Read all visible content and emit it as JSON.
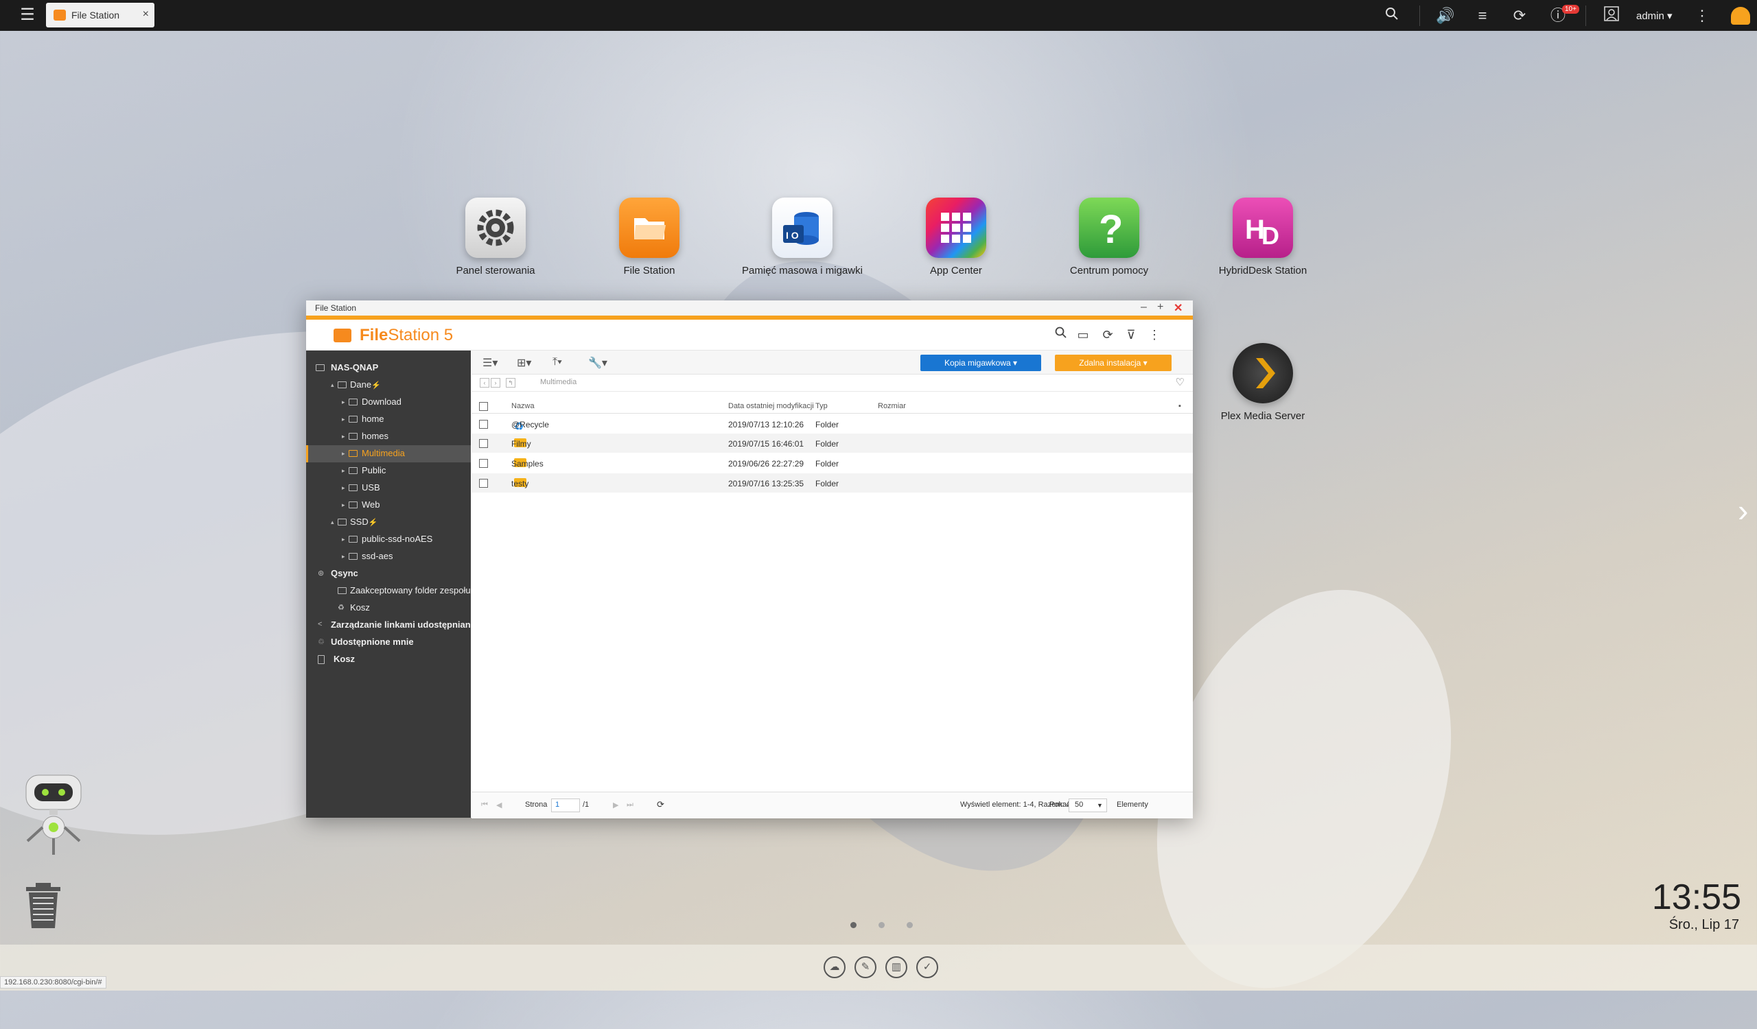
{
  "topbar": {
    "tab_label": "File Station",
    "tab_close": "×",
    "user": "admin ▾",
    "notify_badge": "10+"
  },
  "desktop": {
    "icons": [
      {
        "label": "Panel sterowania"
      },
      {
        "label": "File Station"
      },
      {
        "label": "Pamięć masowa i migawki"
      },
      {
        "label": "App Center"
      },
      {
        "label": "Centrum pomocy"
      },
      {
        "label": "HybridDesk Station"
      },
      {
        "label": "Plex Media Server"
      }
    ],
    "clock": "13:55",
    "date": "Śro., Lip 17",
    "status_url": "192.168.0.230:8080/cgi-bin/#"
  },
  "window": {
    "title": "File Station",
    "brand_bold": "File",
    "brand_rest": "Station 5",
    "btn_snapshot": "Kopia migawkowa ▾",
    "btn_remote": "Zdalna instalacja ▾",
    "path": "Multimedia",
    "sidebar": [
      {
        "label": "NAS-QNAP"
      },
      {
        "label": "Dane"
      },
      {
        "label": "Download"
      },
      {
        "label": "home"
      },
      {
        "label": "homes"
      },
      {
        "label": "Multimedia"
      },
      {
        "label": "Public"
      },
      {
        "label": "USB"
      },
      {
        "label": "Web"
      },
      {
        "label": "SSD"
      },
      {
        "label": "public-ssd-noAES"
      },
      {
        "label": "ssd-aes"
      },
      {
        "label": "Qsync"
      },
      {
        "label": "Zaakceptowany folder zespołu"
      },
      {
        "label": "Kosz"
      },
      {
        "label": "Zarządzanie linkami udostępniania"
      },
      {
        "label": "Udostępnione mnie"
      },
      {
        "label": "Kosz"
      }
    ],
    "columns": {
      "name": "Nazwa",
      "modified": "Data ostatniej modyfikacji",
      "type": "Typ",
      "size": "Rozmiar"
    },
    "rows": [
      {
        "name": "@Recycle",
        "modified": "2019/07/13 12:10:26",
        "type": "Folder"
      },
      {
        "name": "Filmy",
        "modified": "2019/07/15 16:46:01",
        "type": "Folder"
      },
      {
        "name": "Samples",
        "modified": "2019/06/26 22:27:29",
        "type": "Folder"
      },
      {
        "name": "testy",
        "modified": "2019/07/16 13:25:35",
        "type": "Folder"
      }
    ],
    "footer": {
      "page_label": "Strona",
      "page_value": "1",
      "page_total": "/1",
      "display_info": "Wyświetl element: 1-4, Razem: 4",
      "show_label": "Pokaż",
      "show_value": "50",
      "items_label": "Elementy"
    }
  },
  "colors": {
    "accent": "#f7a21e",
    "blue_button": "#1976d2",
    "sidebar_bg": "#3a3a3a",
    "topbar_bg": "#1b1b1b"
  }
}
